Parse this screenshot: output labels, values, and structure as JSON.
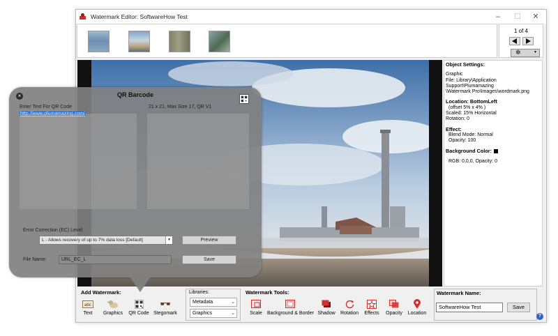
{
  "window": {
    "title": "Watermark Editor: SoftwareHow Test",
    "minimize_icon": "minimize-icon",
    "maximize_icon": "maximize-icon",
    "close_icon": "close-icon"
  },
  "navigation": {
    "page_indicator": "1 of 4",
    "prev_icon": "arrow-left-icon",
    "next_icon": "arrow-right-icon",
    "settings_icon": "gear-icon"
  },
  "thumbnails": [
    {
      "name": "thumbnail-1"
    },
    {
      "name": "thumbnail-2"
    },
    {
      "name": "thumbnail-3"
    },
    {
      "name": "thumbnail-4"
    }
  ],
  "object_settings": {
    "heading": "Object Settings:",
    "type": "Graphic",
    "file_line1": "File: Library\\Application Support\\Plumamazing",
    "file_line2": "\\Watermark Pro\\Images\\wordmark.png",
    "location_heading": "Location: BottomLeft",
    "location_offset": "(offset 5% x 4% )",
    "scaled": "Scaled: 15% Horizontal",
    "rotation": "Rotation: 0",
    "effect_heading": "Effect:",
    "blend_mode": "Blend Mode: Normal",
    "opacity": "Opacity: 100",
    "bg_color_heading": "Background Color:",
    "bg_color_value": "RGB: 0,0,0, Opacity: 0",
    "bg_color_swatch": "#000000"
  },
  "qr_dialog": {
    "title": "QR Barcode",
    "enter_text_label": "Enter Text For QR Code",
    "size_info": "21 x 21, Max Size 17, QR V1",
    "text_value": "http://www.plumamazing.com/",
    "ec_label": "Error Correction (EC) Level:",
    "ec_value": "L -  Allows recovery of up to 7% data loss [Default]",
    "preview_button": "Preview",
    "file_name_label": "File Name:",
    "file_name_value": "URL_EC_L",
    "save_button": "Save"
  },
  "bottom_bar": {
    "add_watermark_label": "Add Watermark:",
    "add_tools": [
      {
        "label": "Text",
        "icon": "text-abc-icon"
      },
      {
        "label": "Graphics",
        "icon": "graphics-icon"
      },
      {
        "label": "QR Code",
        "icon": "qr-code-icon"
      },
      {
        "label": "Stegomark",
        "icon": "sunglasses-icon"
      }
    ],
    "libraries_label": "Libraries:",
    "libraries": [
      "Metadata",
      "Graphics"
    ],
    "watermark_tools_label": "Watermark Tools:",
    "tools": [
      {
        "label": "Scale",
        "icon": "scale-icon"
      },
      {
        "label": "Background & Border",
        "icon": "background-border-icon"
      },
      {
        "label": "Shadow",
        "icon": "shadow-icon"
      },
      {
        "label": "Rotation",
        "icon": "rotation-icon"
      },
      {
        "label": "Effects",
        "icon": "effects-star-icon"
      },
      {
        "label": "Opacity",
        "icon": "opacity-icon"
      },
      {
        "label": "Location",
        "icon": "location-pin-icon"
      }
    ],
    "watermark_name_label": "Watermark Name:",
    "watermark_name_value": "SoftwareHow Test",
    "save_button": "Save",
    "help_icon": "help-icon",
    "help_glyph": "?"
  },
  "colors": {
    "accent": "#1c63c6",
    "tool_red": "#d32f2f",
    "dialog_bg": "#808080"
  }
}
